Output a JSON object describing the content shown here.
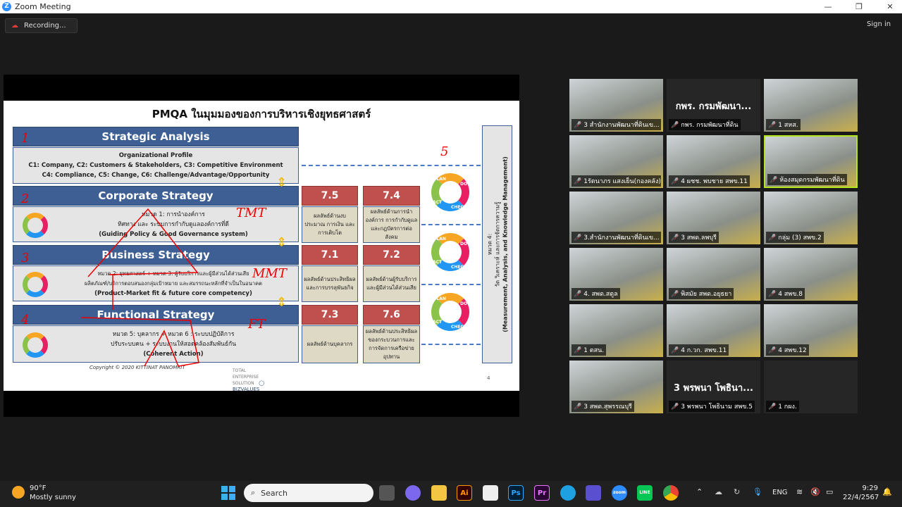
{
  "window": {
    "title": "Zoom Meeting",
    "controls": [
      "minimize",
      "maximize",
      "close"
    ]
  },
  "toolbar": {
    "recording": "Recording...",
    "sign_in": "Sign in"
  },
  "slide": {
    "title": "PMQA ในมุมมองของการบริหารเชิงยุทธศาสตร์",
    "sections": [
      {
        "header": "Strategic Analysis",
        "lines": [
          "Organizational Profile",
          "C1: Company, C2: Customers & Stakeholders, C3: Competitive Environment",
          "C4: Compliance, C5: Change, C6: Challenge/Advantage/Opportunity"
        ]
      },
      {
        "header": "Corporate Strategy",
        "lines": [
          "หมวด 1: การนำองค์การ",
          "ทิศทาง และ ระบบการกำกับดูแลองค์การที่ดี",
          "(Guiding Policy & Good Governance system)"
        ]
      },
      {
        "header": "Business Strategy",
        "lines": [
          "หมวด 2: ยุทธศาสตร์ + หมวด 3: ผู้รับบริการและผู้มีส่วนได้ส่วนเสีย",
          "ผลิตภัณฑ์/บริการตอบสนองกลุ่มเป้าหมาย และสมรรถนะหลักที่จำเป็นในอนาคต",
          "(Product-Market fit & future core competency)"
        ]
      },
      {
        "header": "Functional Strategy",
        "lines": [
          "หมวด 5: บุคลากร + หมวด 6 : ระบบปฏิบัติการ",
          "ปรับระบบคน + ระบบงานให้สอดคล้องสัมพันธ์กัน",
          "(Coherent Action)"
        ]
      }
    ],
    "results": [
      {
        "code": "7.5",
        "text": "ผลลัพธ์ด้านงบประมาณ การเงิน และการเติบโต"
      },
      {
        "code": "7.4",
        "text": "ผลลัพธ์ด้านการนำองค์การ การกำกับดูแล และกฎบัตรการต่อสังคม"
      },
      {
        "code": "7.1",
        "text": "ผลลัพธ์ด้านประสิทธิผล และการบรรลุพันธกิจ"
      },
      {
        "code": "7.2",
        "text": "ผลลัพธ์ด้านผู้รับบริการและผู้มีส่วนได้ส่วนเสีย"
      },
      {
        "code": "7.3",
        "text": "ผลลัพธ์ด้านบุคลากร"
      },
      {
        "code": "7.6",
        "text": "ผลลัพธ์ด้านประสิทธิผลของกระบวนการและการจัดการเครือข่ายอุปทาน"
      }
    ],
    "side_panel": {
      "line1": "หมวด 4:",
      "line2": "วัด วิเคราะห์ และการจัดการความรู้",
      "line3": "(Measurement, Analysis, and Knowledge Management)"
    },
    "cycle_labels": [
      "PLAN",
      "DO",
      "CHECK",
      "ACT"
    ],
    "copyright": "Copyright © 2020 KITTINAT PANOMRIT",
    "logo_text": "TOTAL ENTERPRISE SOLUTION BIZVALUES",
    "page_number": "4",
    "annotations": [
      "1",
      "2",
      "3",
      "4",
      "5",
      "TMT",
      "MMT",
      "FT"
    ]
  },
  "gallery": [
    {
      "name": "3 สำนักงานพัฒนาที่ดินเข...",
      "video": true
    },
    {
      "name": "กพร. กรมพัฒนาที่ดิน",
      "big": "กพร. กรมพัฒนา...",
      "video": false
    },
    {
      "name": "1 สหส.",
      "video": true
    },
    {
      "name": "1รัตนาภร แสงเย็น(กองคลัง)",
      "video": true
    },
    {
      "name": "4 ผชช. พบชาย สพข.11",
      "video": true
    },
    {
      "name": "ห้องสมุดกรมพัฒนาที่ดิน",
      "video": true,
      "active": true
    },
    {
      "name": "3.สำนักงานพัฒนาที่ดินเข...",
      "video": true
    },
    {
      "name": "3 สพด.ลพบุรี",
      "video": true
    },
    {
      "name": "กลุ่ม (3) สพข.2",
      "video": true
    },
    {
      "name": "4. สพด.สตูล",
      "video": true
    },
    {
      "name": "พิสมัย สพด.อยุธยา",
      "video": true
    },
    {
      "name": "4 สพข.8",
      "video": true
    },
    {
      "name": "1 ตสน.",
      "video": true
    },
    {
      "name": "4 ก.วก. สพข.11",
      "video": true
    },
    {
      "name": "4 สพข.12",
      "video": true
    },
    {
      "name": "3 สพด.สุพรรณบุรี",
      "video": true
    },
    {
      "name": "3 พรพนา โพธินาม สพข.5",
      "big": "3 พรพนา โพธินา...",
      "video": false
    },
    {
      "name": "1 กผง.",
      "video": false
    }
  ],
  "taskbar": {
    "weather_temp": "90°F",
    "weather_desc": "Mostly sunny",
    "search_placeholder": "Search",
    "apps": [
      {
        "label": "Ai",
        "color": "#ff9a00",
        "bg": "#330000"
      },
      {
        "label": "Ps",
        "color": "#31a8ff",
        "bg": "#001e36"
      },
      {
        "label": "Pr",
        "color": "#ea77ff",
        "bg": "#2a0634"
      },
      {
        "label": "zoom",
        "color": "#fff",
        "bg": "#2d8cff"
      },
      {
        "label": "LINE",
        "color": "#fff",
        "bg": "#06c755"
      }
    ],
    "language": "ENG",
    "time": "9:29",
    "date": "22/4/2567"
  }
}
